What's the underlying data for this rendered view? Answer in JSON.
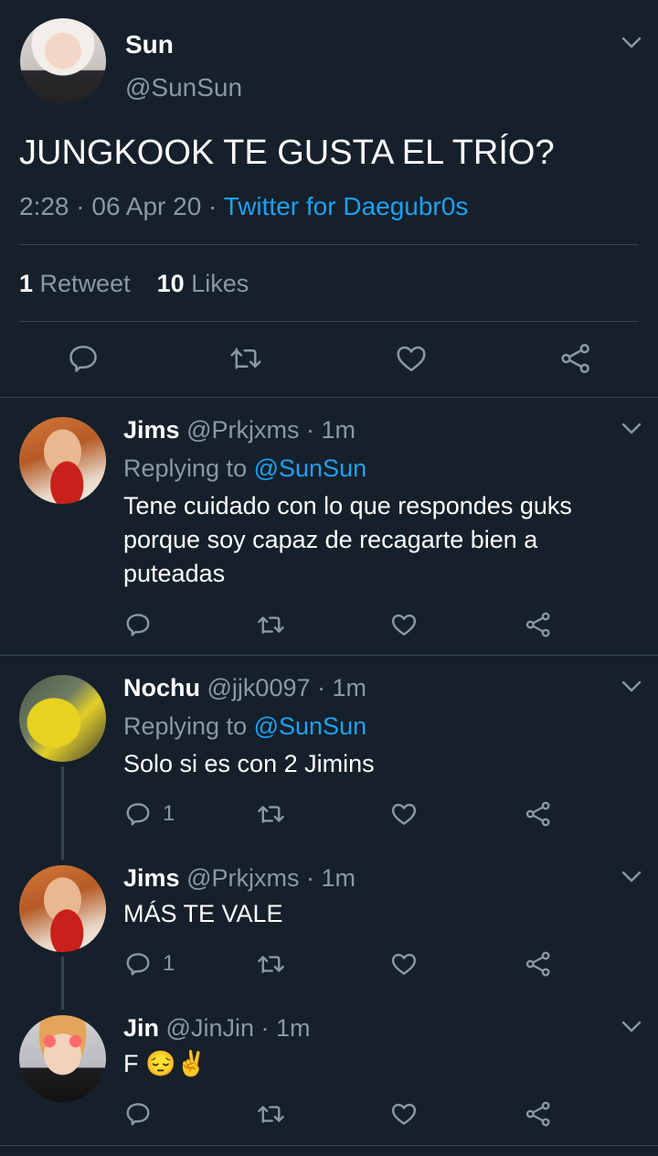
{
  "main_tweet": {
    "name": "Sun",
    "handle": "@SunSun",
    "text": "JUNGKOOK TE GUSTA EL TRÍO?",
    "time": "2:28",
    "sep1": "·",
    "date": "06 Apr 20",
    "sep2": "·",
    "source": "Twitter for Daegubr0s",
    "retweets_count": "1",
    "retweets_label": "Retweet",
    "likes_count": "10",
    "likes_label": "Likes"
  },
  "replies": [
    {
      "name": "Jims",
      "meta": "@Prkjxms · 1m",
      "replying_prefix": "Replying to",
      "replying_to": "@SunSun",
      "text": "Tene cuidado con lo que respondes guks porque soy capaz de recagarte bien a puteadas",
      "reply_count": ""
    },
    {
      "name": "Nochu",
      "meta": "@jjk0097 · 1m",
      "replying_prefix": "Replying to",
      "replying_to": "@SunSun",
      "text": "Solo si es con 2 Jimins",
      "reply_count": "1"
    },
    {
      "name": "Jims",
      "meta": "@Prkjxms · 1m",
      "text": "MÁS TE VALE",
      "reply_count": "1"
    },
    {
      "name": "Jin",
      "meta": "@JinJin · 1m",
      "text": "F 😔✌",
      "reply_count": ""
    }
  ],
  "icons": {
    "reply": "speech-bubble-icon",
    "retweet": "retweet-icon",
    "like": "heart-icon",
    "share": "share-icon",
    "more": "chevron-down-icon"
  },
  "colors": {
    "background": "#15202b",
    "divider": "#38444d",
    "muted": "#8899a6",
    "accent": "#1da1f2"
  }
}
